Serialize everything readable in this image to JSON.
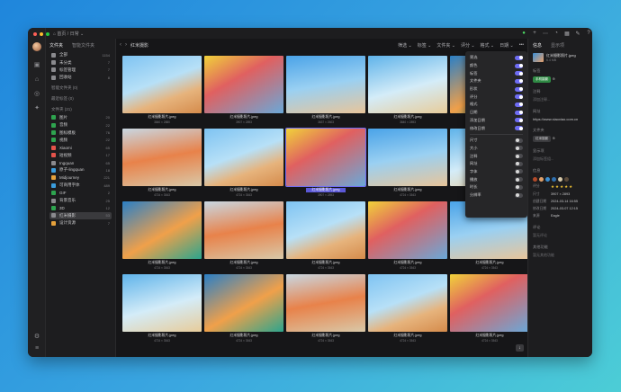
{
  "breadcrumb": "⌂ 首页 / 日常 ⌄",
  "sidebar": {
    "tabs": [
      "文件夹",
      "智能文件夹"
    ],
    "groups": [
      {
        "name": "全部",
        "count": "1154",
        "color": "#8a8a8e"
      },
      {
        "name": "未分类",
        "count": "7",
        "color": "#8a8a8e"
      },
      {
        "name": "标签管理",
        "count": "7",
        "color": "#8a8a8e"
      },
      {
        "name": "回收站",
        "count": "8",
        "color": "#8a8a8e"
      }
    ],
    "smart_label": "智能文件夹 (0)",
    "tag_label": "最近标签 (0)",
    "folder_label": "文件夹 (21)",
    "folders": [
      {
        "name": "图片",
        "count": "20",
        "color": "#2ea44f"
      },
      {
        "name": "音频",
        "count": "22",
        "color": "#2ea44f"
      },
      {
        "name": "图标模板",
        "count": "76",
        "color": "#2ea44f"
      },
      {
        "name": "视频",
        "count": "22",
        "color": "#2ea44f"
      },
      {
        "name": "Xiaomi",
        "count": "65",
        "color": "#e5534b"
      },
      {
        "name": "短视频",
        "count": "17",
        "color": "#e5534b"
      },
      {
        "name": "Ingquan",
        "count": "65",
        "color": "#8a8a8e"
      },
      {
        "name": "原子-lingquan",
        "count": "18",
        "color": "#3a9dde"
      },
      {
        "name": "Midjourney",
        "count": "221",
        "color": "#e5a13b"
      },
      {
        "name": "可商用字体",
        "count": "489",
        "color": "#3a9dde"
      },
      {
        "name": "GIF",
        "count": "2",
        "color": "#2ea44f"
      },
      {
        "name": "背景音乐",
        "count": "25",
        "color": "#8a8a8e"
      },
      {
        "name": "3D",
        "count": "12",
        "color": "#2ea44f"
      },
      {
        "name": "红米摄影",
        "count": "53",
        "color": "#8a8a8e",
        "selected": true
      },
      {
        "name": "设计资源",
        "count": "7",
        "color": "#e5a13b"
      }
    ]
  },
  "toolbar": {
    "title": "红米摄影",
    "options": [
      "筛选 ⌄",
      "标签 ⌄",
      "文件夹 ⌄",
      "评分 ⌄",
      "格式 ⌄",
      "日期 ⌄",
      "•••"
    ]
  },
  "grid": {
    "items": [
      {
        "name": "红米摄影照片.jpeg",
        "dims": "3840 × 2880"
      },
      {
        "name": "红米摄影照片.jpeg",
        "dims": "3907 × 2893"
      },
      {
        "name": "红米摄影照片.jpeg",
        "dims": "3637 × 2603"
      },
      {
        "name": "红米摄影照片.jpeg",
        "dims": "3840 × 2893"
      },
      {
        "name": "红米摄影照片.jpeg",
        "dims": "3840 × 2893"
      },
      {
        "name": "红米摄影照片.jpeg",
        "dims": "4724 × 3543"
      },
      {
        "name": "红米摄影照片.jpeg",
        "dims": "4724 × 3543"
      },
      {
        "name": "红米摄影照片.jpeg",
        "dims": "3907 × 2893",
        "selected": true
      },
      {
        "name": "红米摄影照片.jpeg",
        "dims": "4724 × 3543"
      },
      {
        "name": "红米摄影照片.jpeg",
        "dims": "3907 × 2893"
      },
      {
        "name": "红米摄影照片.jpeg",
        "dims": "4724 × 3543"
      },
      {
        "name": "红米摄影照片.jpeg",
        "dims": "4724 × 3543"
      },
      {
        "name": "红米摄影照片.jpeg",
        "dims": "4724 × 3543"
      },
      {
        "name": "红米摄影照片.jpeg",
        "dims": "4724 × 3543"
      },
      {
        "name": "红米摄影照片.jpeg",
        "dims": "4724 × 3543"
      },
      {
        "name": "红米摄影照片.jpeg",
        "dims": "4724 × 3543"
      },
      {
        "name": "红米摄影照片.jpeg",
        "dims": "4724 × 3543"
      },
      {
        "name": "红米摄影照片.jpeg",
        "dims": "4724 × 3543"
      },
      {
        "name": "红米摄影照片.jpeg",
        "dims": "4724 × 3543"
      },
      {
        "name": "红米摄影照片.jpeg",
        "dims": "4724 × 3543"
      }
    ]
  },
  "dropdown": {
    "group1": [
      {
        "label": "筛选",
        "on": true
      },
      {
        "label": "颜色",
        "on": true
      },
      {
        "label": "标签",
        "on": true
      },
      {
        "label": "文件夹",
        "on": true
      },
      {
        "label": "形状",
        "on": true
      },
      {
        "label": "评分",
        "on": true
      },
      {
        "label": "格式",
        "on": true
      },
      {
        "label": "日期",
        "on": true
      },
      {
        "label": "添加日期",
        "on": true
      },
      {
        "label": "修改日期",
        "on": true
      }
    ],
    "group2": [
      {
        "label": "尺寸",
        "on": false
      },
      {
        "label": "大小",
        "on": false
      },
      {
        "label": "注释",
        "on": false
      },
      {
        "label": "网址",
        "on": false
      },
      {
        "label": "字体",
        "on": false
      },
      {
        "label": "播放",
        "on": false
      },
      {
        "label": "时长",
        "on": false
      },
      {
        "label": "分辨率",
        "on": false
      }
    ]
  },
  "inspector": {
    "tabs": [
      "信息",
      "显示项"
    ],
    "file_name": "红米摄影照片.jpeg",
    "file_size": "6.4 MB",
    "tag_label": "标签",
    "tag": "手机摄影",
    "note_label": "注释",
    "note_placeholder": "添加注释...",
    "url_label": "网址",
    "url": "https://www.xiaoxiao.com.cn",
    "folder_label": "文件夹",
    "folder": "红米摄影",
    "show_label": "显示项",
    "show_value": "添加标签组...",
    "info_label": "信息",
    "swatch_colors": [
      "#b24a2a",
      "#e0a06a",
      "#3c8ecf",
      "#2f6fae",
      "#d7c9a9",
      "#5a4a3a"
    ],
    "rating_key": "评分",
    "rating": "★★★★★",
    "kv": [
      {
        "k": "尺寸",
        "v": "3907 × 2893"
      },
      {
        "k": "创建日期",
        "v": "2024-03-14 16:55"
      },
      {
        "k": "修改日期",
        "v": "2024-03-07 12:15"
      },
      {
        "k": "来源",
        "v": "Eagle"
      }
    ],
    "comment_label": "评论",
    "comment_value": "暂无评论",
    "more_label": "其他功能",
    "more_value": "暂无其他功能"
  }
}
